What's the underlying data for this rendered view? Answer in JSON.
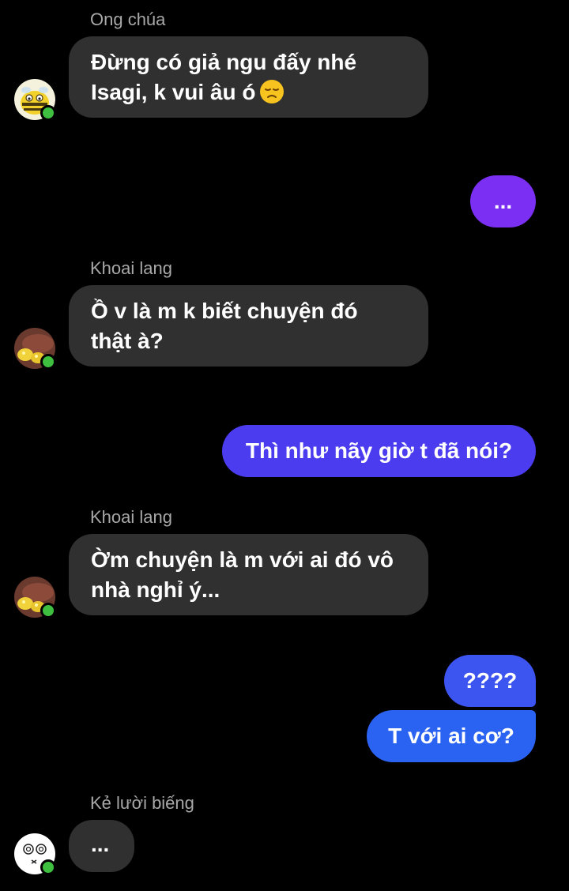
{
  "messages": [
    {
      "sender": "Ong chúa",
      "text": "Đừng có giả ngu đấy nhé\nIsagi, k vui âu ó",
      "emoji": "disappointed-face",
      "avatar": "bee-avatar"
    },
    {
      "outgoing": "...",
      "color": "#7b2ff2"
    },
    {
      "sender": "Khoai lang",
      "text": "Ồ v là m k biết chuyện đó\nthật à?",
      "avatar": "sweet-potato-avatar"
    },
    {
      "outgoing": "Thì như nãy giờ t đã nói?",
      "color": "#4c3cf0"
    },
    {
      "sender": "Khoai lang",
      "text": "Ờm chuyện là m với ai đó vô\nnhà nghỉ ý...",
      "avatar": "sweet-potato-avatar"
    },
    {
      "outgoing": "????",
      "color": "#3c54f0"
    },
    {
      "outgoing": "T với ai cơ?",
      "color": "#2a62f2"
    },
    {
      "sender": "Kẻ lười biếng",
      "text": "...",
      "avatar": "sleepy-face-avatar"
    }
  ],
  "colors": {
    "background": "#000000",
    "incoming_bubble": "#303030",
    "online": "#3fbf3f"
  }
}
